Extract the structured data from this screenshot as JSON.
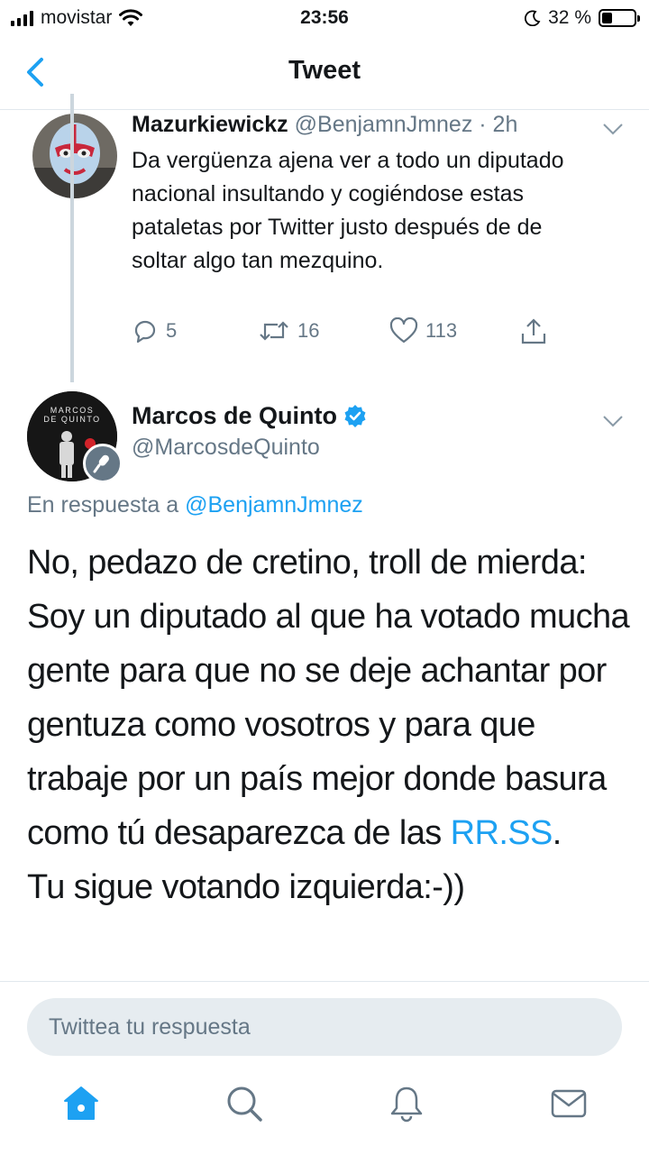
{
  "status_bar": {
    "carrier": "movistar",
    "time": "23:56",
    "battery_text": "32 %",
    "battery_level": 0.32
  },
  "nav": {
    "title": "Tweet",
    "back_icon": "chevron-left-icon"
  },
  "reply_tweet": {
    "name": "Mazurkiewickz",
    "handle": "@BenjamnJmnez",
    "time": "· 2h",
    "text": "Da vergüenza ajena ver a todo un diputado nacional insultando y cogiéndose estas pataletas por Twitter justo después de de soltar algo tan mezquino.",
    "actions": {
      "replies": "5",
      "retweets": "16",
      "likes": "113"
    }
  },
  "main_tweet": {
    "name": "Marcos de Quinto",
    "handle": "@MarcosdeQuinto",
    "reply_prefix": "En respuesta a",
    "reply_mention": "@BenjamnJmnez",
    "avatar_text_line1": "MARCOS",
    "avatar_text_line2": "DE QUINTO",
    "text_part1": "No, pedazo de cretino, troll de mierda: Soy un diputado al que ha votado mucha gente para que no se deje achantar por gentuza como vosotros y para que trabaje por un país mejor donde basura como tú desaparezca de las ",
    "text_link": "RR.SS",
    "text_part2": ".",
    "text_part3": "Tu sigue votando izquierda:-))"
  },
  "composer": {
    "placeholder": "Twittea tu respuesta"
  },
  "colors": {
    "accent": "#1da1f2",
    "secondary_text": "#657786",
    "primary_text": "#14171a"
  }
}
